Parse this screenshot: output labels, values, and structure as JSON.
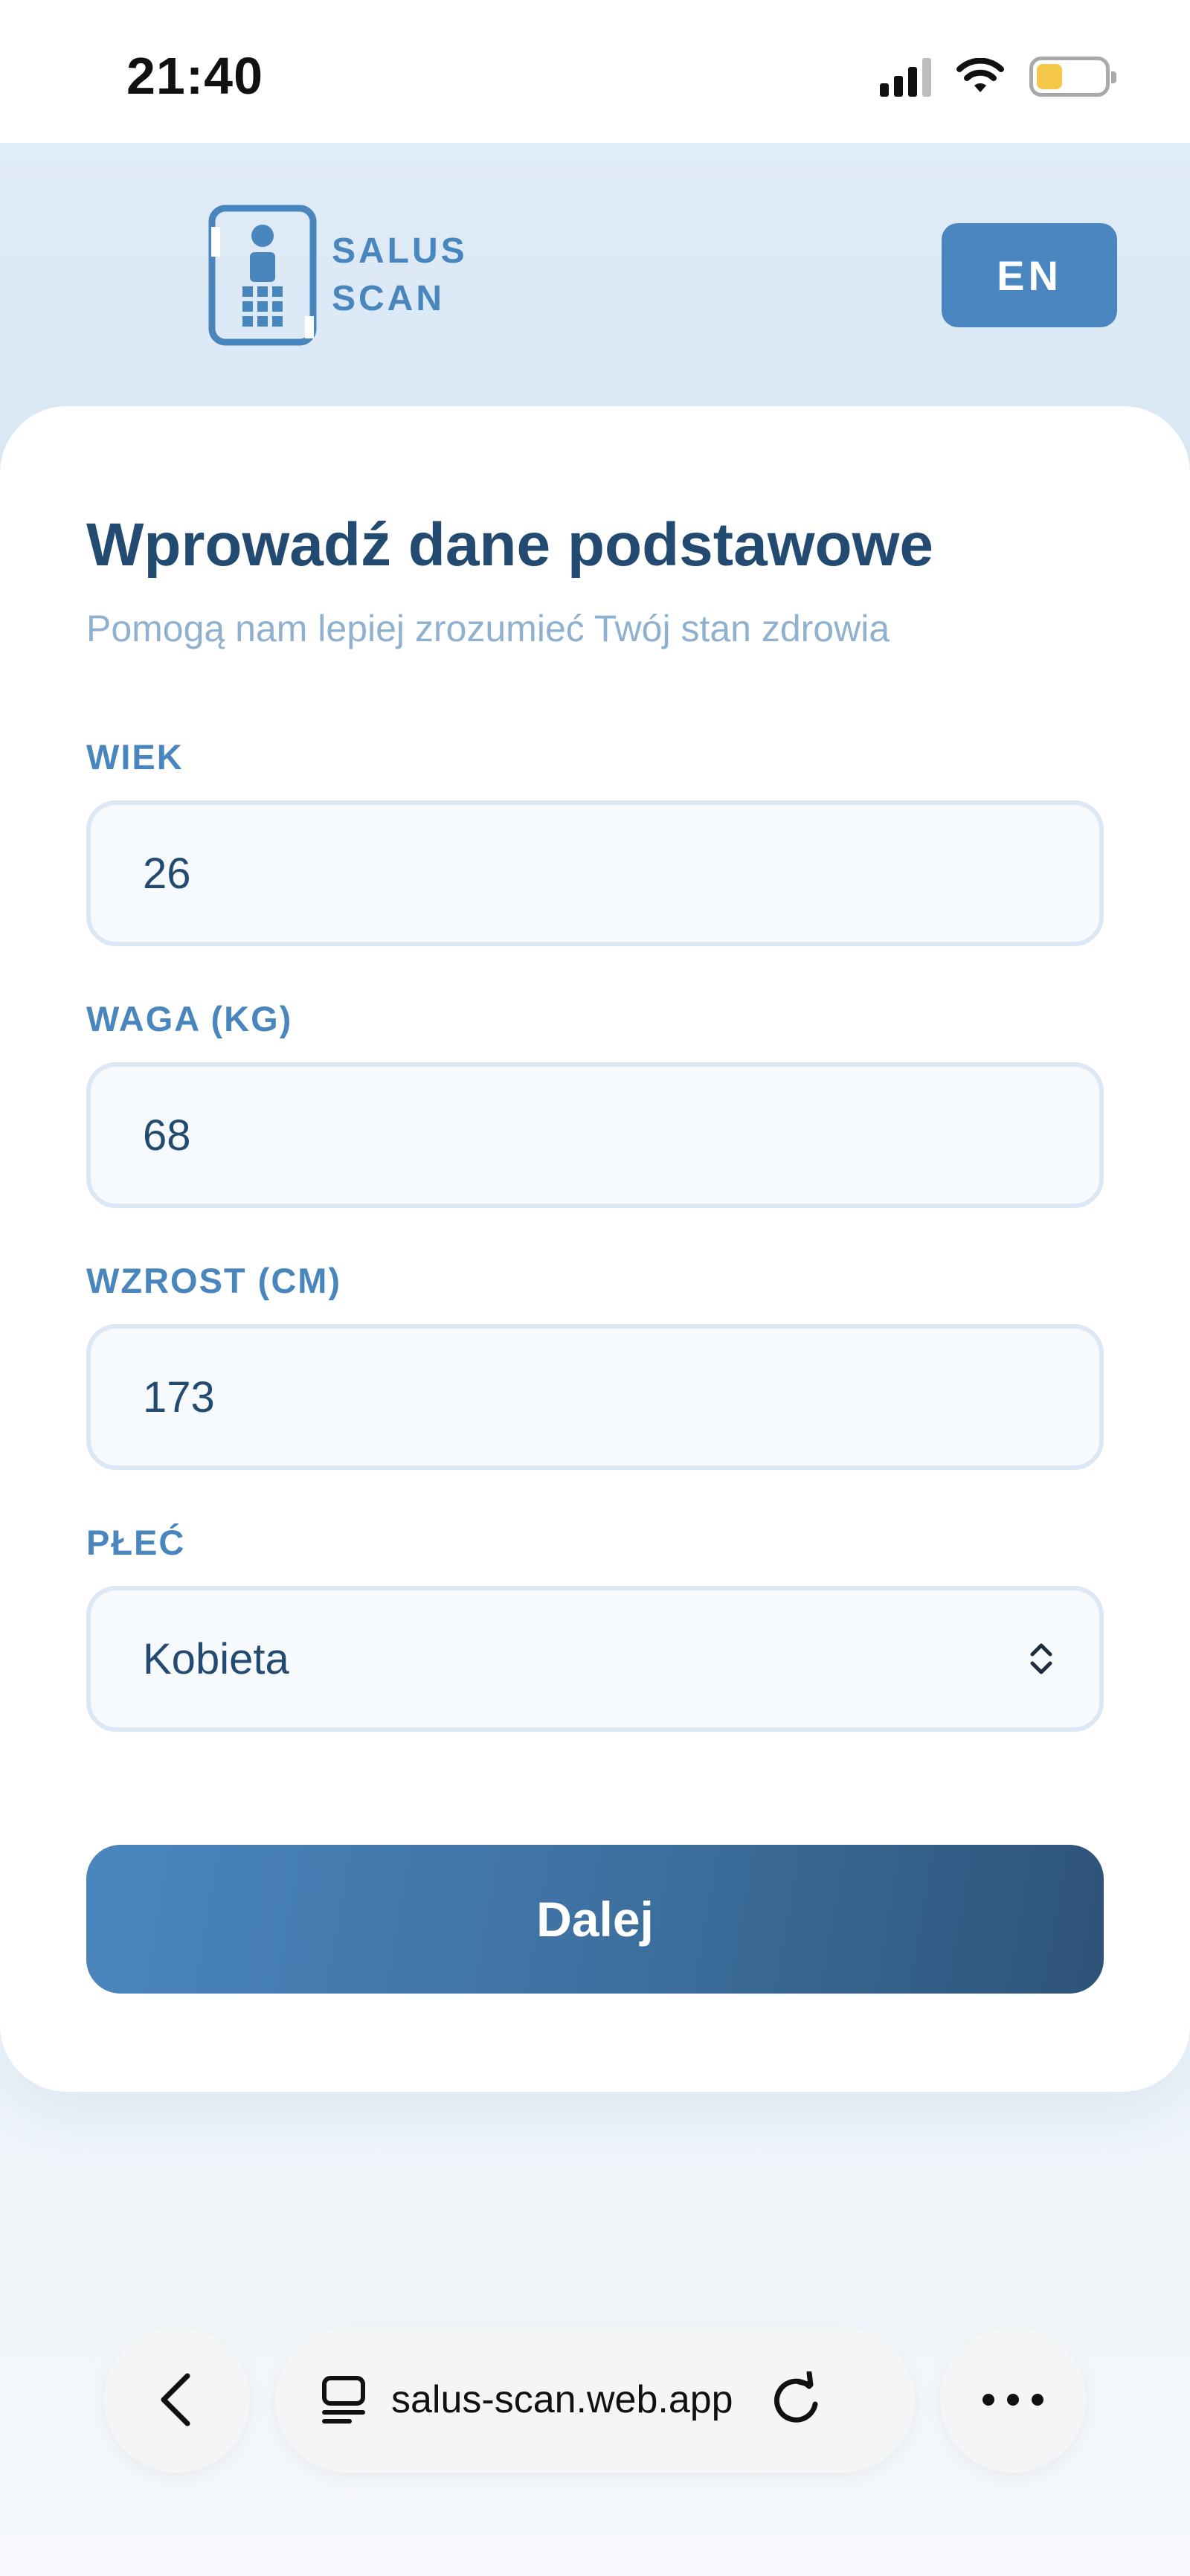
{
  "status_bar": {
    "time": "21:40"
  },
  "header": {
    "logo_line1": "SALUS",
    "logo_line2": "SCAN",
    "lang_button": "EN"
  },
  "form": {
    "title": "Wprowadź dane podstawowe",
    "subtitle": "Pomogą nam lepiej zrozumieć Twój stan zdrowia",
    "fields": [
      {
        "label": "WIEK",
        "value": "26"
      },
      {
        "label": "WAGA (KG)",
        "value": "68"
      },
      {
        "label": "WZROST (CM)",
        "value": "173"
      },
      {
        "label": "PŁEĆ",
        "value": "Kobieta"
      }
    ],
    "submit_label": "Dalej"
  },
  "browser": {
    "url": "salus-scan.web.app"
  },
  "colors": {
    "brand": "#4a86be",
    "title": "#234a70",
    "battery": "#f5c84a"
  }
}
